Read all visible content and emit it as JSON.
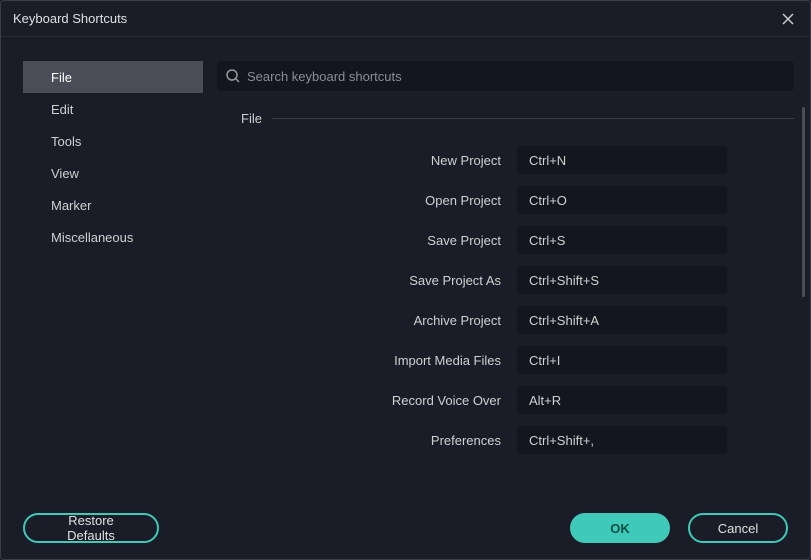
{
  "window": {
    "title": "Keyboard Shortcuts"
  },
  "sidebar": {
    "items": [
      {
        "label": "File",
        "active": true
      },
      {
        "label": "Edit",
        "active": false
      },
      {
        "label": "Tools",
        "active": false
      },
      {
        "label": "View",
        "active": false
      },
      {
        "label": "Marker",
        "active": false
      },
      {
        "label": "Miscellaneous",
        "active": false
      }
    ]
  },
  "search": {
    "placeholder": "Search keyboard shortcuts"
  },
  "section": {
    "header": "File"
  },
  "shortcuts": [
    {
      "label": "New Project",
      "value": "Ctrl+N"
    },
    {
      "label": "Open Project",
      "value": "Ctrl+O"
    },
    {
      "label": "Save Project",
      "value": "Ctrl+S"
    },
    {
      "label": "Save Project As",
      "value": "Ctrl+Shift+S"
    },
    {
      "label": "Archive Project",
      "value": "Ctrl+Shift+A"
    },
    {
      "label": "Import Media Files",
      "value": "Ctrl+I"
    },
    {
      "label": "Record Voice Over",
      "value": "Alt+R"
    },
    {
      "label": "Preferences",
      "value": "Ctrl+Shift+,"
    }
  ],
  "footer": {
    "restore": "Restore Defaults",
    "ok": "OK",
    "cancel": "Cancel"
  },
  "colors": {
    "accent": "#3fc9b8",
    "background": "#1a1d28",
    "input_bg": "#14161f"
  }
}
